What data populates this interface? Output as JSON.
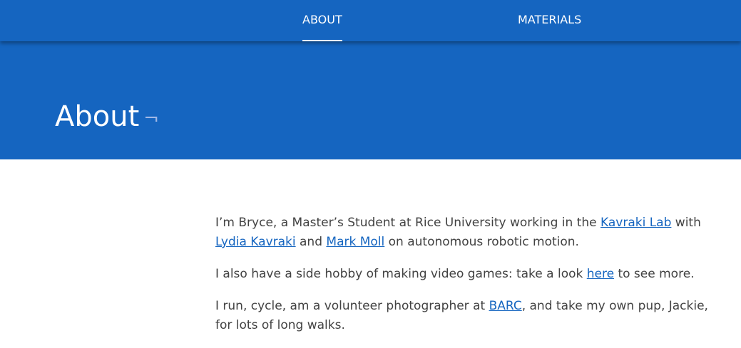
{
  "nav": {
    "items": [
      {
        "label": "ABOUT",
        "active": true
      },
      {
        "label": "MATERIALS",
        "active": false
      }
    ]
  },
  "hero": {
    "title": "About",
    "anchor_symbol": "¬"
  },
  "content": {
    "p1": {
      "t1": "I’m Bryce, a Master’s Student at Rice University working in the ",
      "link_kavraki_lab": "Kavraki Lab",
      "t2": " with ",
      "link_lydia": "Lydia Kavraki",
      "t3": " and ",
      "link_mark": "Mark Moll",
      "t4": " on autonomous robotic motion."
    },
    "p2": {
      "t1": "I also have a side hobby of making video games: take a look ",
      "link_here": "here",
      "t2": " to see more."
    },
    "p3": {
      "t1": "I run, cycle, am a volunteer photographer at ",
      "link_barc": "BARC",
      "t2": ", and take my own pup, Jackie, for lots of long walks."
    }
  },
  "colors": {
    "brand": "#1565c0",
    "text": "#424242",
    "link": "#1565c0"
  }
}
